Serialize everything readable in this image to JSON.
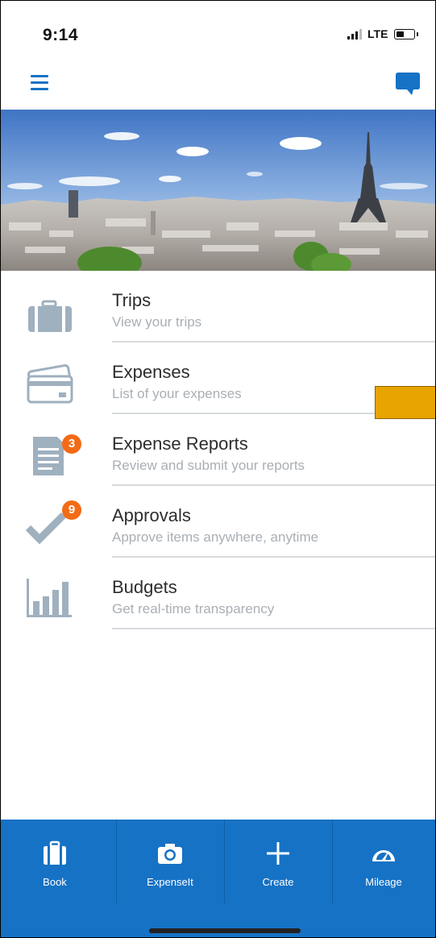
{
  "status_bar": {
    "time": "9:14",
    "network": "LTE",
    "signal_bars_filled": 3,
    "signal_bars_total": 4,
    "battery_level": 0.45
  },
  "header": {
    "menu_icon": "hamburger-menu-icon",
    "chat_icon": "chat-bubble-icon"
  },
  "hero": {
    "image": "paris-skyline-with-eiffel-tower"
  },
  "menu": [
    {
      "title": "Trips",
      "subtitle": "View your trips",
      "icon": "briefcase-icon",
      "badge": ""
    },
    {
      "title": "Expenses",
      "subtitle": "List of your expenses",
      "icon": "credit-card-icon",
      "badge": ""
    },
    {
      "title": "Expense Reports",
      "subtitle": "Review and submit your reports",
      "icon": "document-icon",
      "badge": "3"
    },
    {
      "title": "Approvals",
      "subtitle": "Approve items anywhere, anytime",
      "icon": "checkmark-icon",
      "badge": "9"
    },
    {
      "title": "Budgets",
      "subtitle": "Get real-time transparency",
      "icon": "bar-chart-icon",
      "badge": ""
    }
  ],
  "tabbar": [
    {
      "label": "Book",
      "icon": "briefcase-icon"
    },
    {
      "label": "ExpenseIt",
      "icon": "camera-icon"
    },
    {
      "label": "Create",
      "icon": "plus-icon"
    },
    {
      "label": "Mileage",
      "icon": "speedometer-icon"
    }
  ],
  "colors": {
    "brand_blue": "#1672c5",
    "badge_orange": "#f26b16",
    "icon_gray": "#9fb0bf",
    "highlight": "#e8a400"
  }
}
